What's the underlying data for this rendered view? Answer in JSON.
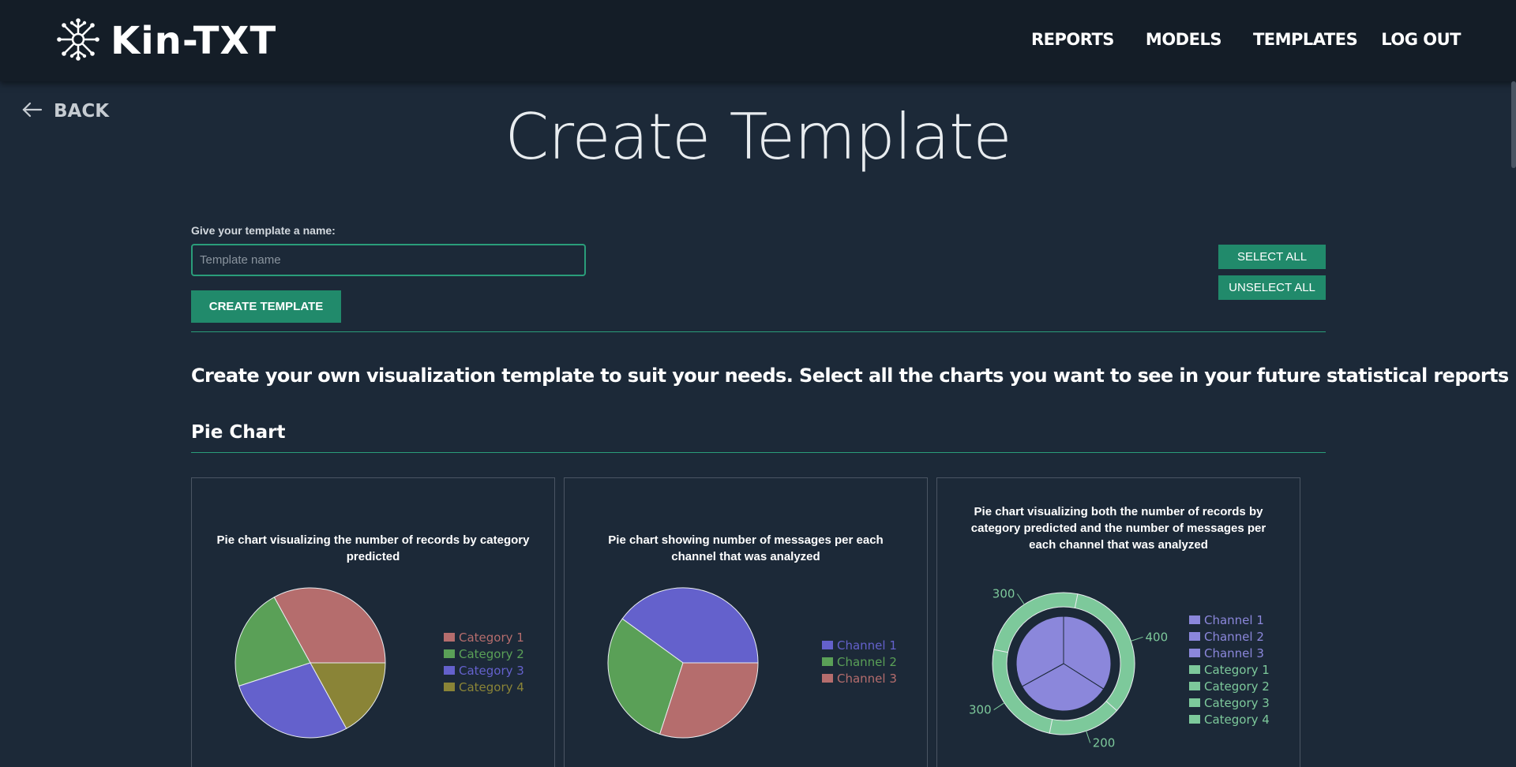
{
  "app": {
    "brand": "Kin-TXT"
  },
  "nav": {
    "items": [
      "REPORTS",
      "MODELS",
      "TEMPLATES",
      "LOG OUT"
    ]
  },
  "back": {
    "label": "BACK"
  },
  "page": {
    "title": "Create Template"
  },
  "form": {
    "name_label": "Give your template a name:",
    "name_placeholder": "Template name",
    "name_value": "",
    "create_button": "CREATE TEMPLATE",
    "select_all": "SELECT ALL",
    "unselect_all": "UNSELECT ALL"
  },
  "intro": "Create your own visualization template to suit your needs. Select all the charts you want to see in your future statistical reports",
  "section": {
    "title": "Pie Chart"
  },
  "cards": [
    {
      "title": "Pie chart visualizing the number of records by category predicted"
    },
    {
      "title": "Pie chart showing number of messages per each channel that was analyzed"
    },
    {
      "title": "Pie chart visualizing both the number of records by category predicted and the number of messages per each channel that was analyzed"
    }
  ],
  "colors": {
    "accent": "#218a6b",
    "accent_border": "#2a9d7a",
    "background": "#1c2938",
    "header": "#141d27",
    "red": "#b56d6d",
    "green": "#5aa057",
    "blue": "#6461cc",
    "olive": "#8a8437",
    "light_blue": "#8b87db",
    "light_green": "#7dc99b"
  },
  "icons": {
    "logo": "network-molecule-icon",
    "back": "arrow-left-icon"
  },
  "chart_data": [
    {
      "type": "pie",
      "title": "Pie chart visualizing the number of records by category predicted",
      "categories": [
        "Category 1",
        "Category 2",
        "Category 3",
        "Category 4"
      ],
      "values": [
        33,
        22,
        28,
        17
      ],
      "colors": [
        "#b56d6d",
        "#5aa057",
        "#6461cc",
        "#8a8437"
      ],
      "legend": "right"
    },
    {
      "type": "pie",
      "title": "Pie chart showing number of messages per each channel that was analyzed",
      "categories": [
        "Channel 1",
        "Channel 2",
        "Channel 3"
      ],
      "values": [
        40,
        30,
        30
      ],
      "colors": [
        "#6461cc",
        "#5aa057",
        "#b56d6d"
      ],
      "legend": "right"
    },
    {
      "type": "pie",
      "title": "Pie chart visualizing both the number of records by category predicted and the number of messages per each channel that was analyzed",
      "inner": {
        "categories": [
          "Channel 1",
          "Channel 2",
          "Channel 3"
        ],
        "values": [
          34,
          33,
          33
        ],
        "color": "#8b87db"
      },
      "outer": {
        "categories": [
          "Category 1",
          "Category 2",
          "Category 3",
          "Category 4"
        ],
        "values": [
          400,
          200,
          300,
          300
        ],
        "labels": [
          "400",
          "200",
          "300",
          "300"
        ],
        "color": "#7dc99b"
      },
      "legend_entries": [
        "Channel 1",
        "Channel 2",
        "Channel 3",
        "Category 1",
        "Category 2",
        "Category 3",
        "Category 4"
      ],
      "legend": "right"
    }
  ]
}
